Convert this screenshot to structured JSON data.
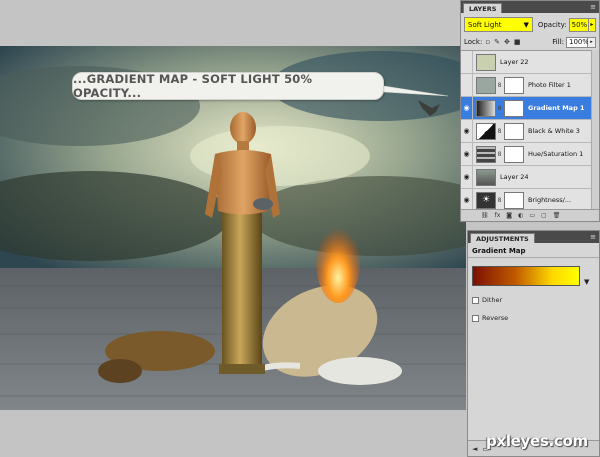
{
  "canvas": {
    "callout_text": "...GRADIENT MAP - SOFT LIGHT 50% OPACITY..."
  },
  "layers_panel": {
    "tab": "LAYERS",
    "menu_icon": "panel-menu-icon",
    "blend_mode": "Soft Light",
    "opacity_label": "Opacity:",
    "opacity_value": "50%",
    "lock_label": "Lock:",
    "fill_label": "Fill:",
    "fill_value": "100%",
    "layers": [
      {
        "name": "Layer 22",
        "visible": false,
        "has_mask": false,
        "thumb": "#c8d0b0"
      },
      {
        "name": "Photo Filter 1",
        "visible": false,
        "has_mask": true,
        "thumb": "#9aa7a0"
      },
      {
        "name": "Gradient Map 1",
        "visible": true,
        "has_mask": true,
        "selected": true,
        "thumb": "#555"
      },
      {
        "name": "Black & White 3",
        "visible": true,
        "has_mask": true,
        "thumb": "#444"
      },
      {
        "name": "Hue/Saturation 1",
        "visible": true,
        "has_mask": true,
        "thumb": "#777"
      },
      {
        "name": "Layer 24",
        "visible": true,
        "has_mask": false,
        "thumb": "#6f7a78"
      },
      {
        "name": "Brightness/...",
        "visible": true,
        "has_mask": true,
        "thumb": "#333"
      }
    ]
  },
  "adjustments_panel": {
    "tab": "ADJUSTMENTS",
    "title": "Gradient Map",
    "gradient_colors": [
      "#7a1000",
      "#c05a00",
      "#ffd800",
      "#ffff00"
    ],
    "dither_label": "Dither",
    "reverse_label": "Reverse"
  },
  "watermark": "pxleyes.com"
}
